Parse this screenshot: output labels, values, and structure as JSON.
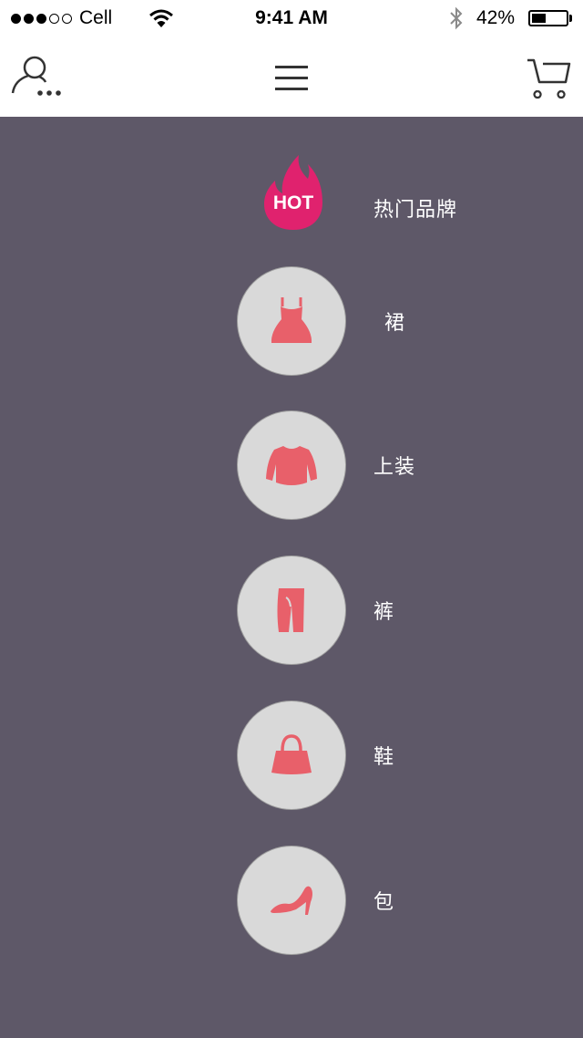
{
  "status_bar": {
    "carrier": "Cell",
    "signal_dots_filled": 3,
    "signal_dots_total": 5,
    "time": "9:41 AM",
    "battery_percent_text": "42%",
    "battery_level": 0.42
  },
  "nav": {
    "left_icon": "user-more-icon",
    "center_icon": "hamburger-menu-icon",
    "right_icon": "shopping-cart-icon"
  },
  "colors": {
    "background": "#5e5868",
    "circle": "#d9d9d9",
    "icon_accent": "#e8606a",
    "hot_badge": "#e0226e",
    "text": "#ffffff"
  },
  "hot": {
    "badge_text": "HOT",
    "label": "热门品牌",
    "icon": "flame-icon"
  },
  "categories": [
    {
      "label": "裙",
      "icon": "dress-icon"
    },
    {
      "label": "上装",
      "icon": "top-icon"
    },
    {
      "label": "裤",
      "icon": "pants-icon"
    },
    {
      "label": "鞋",
      "icon": "handbag-icon"
    },
    {
      "label": "包",
      "icon": "high-heel-icon"
    }
  ]
}
